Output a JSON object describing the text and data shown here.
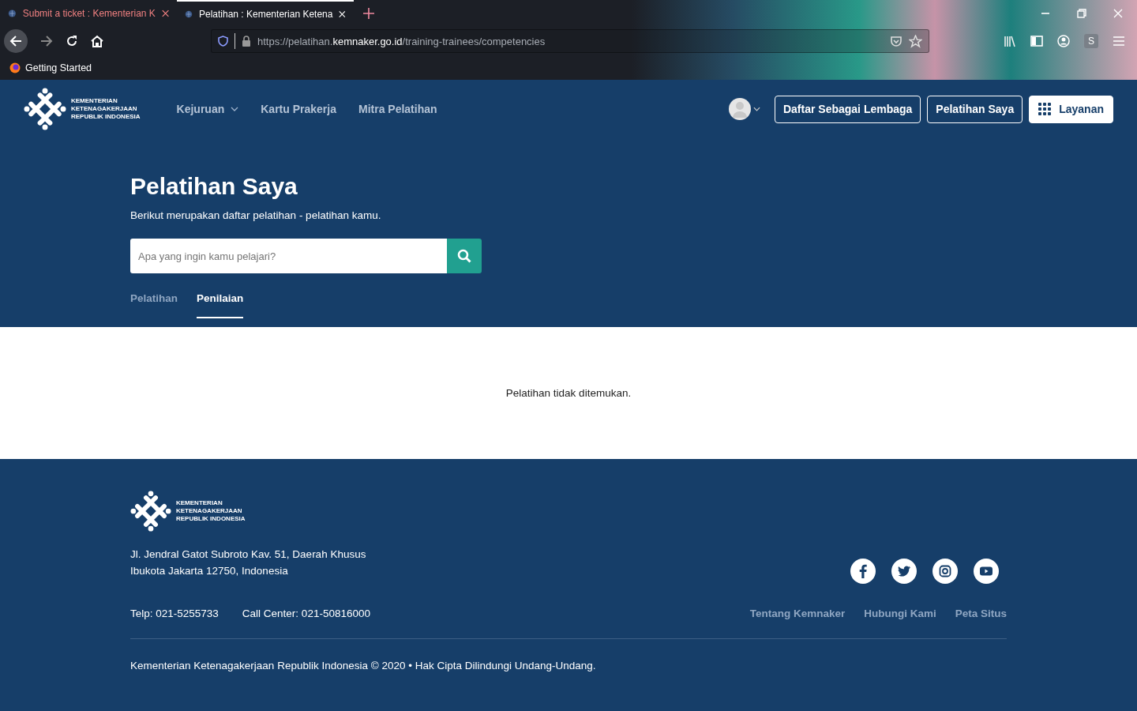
{
  "browser": {
    "tabs": [
      {
        "title": "Submit a ticket : Kementerian K",
        "selected": false
      },
      {
        "title": "Pelatihan : Kementerian Ketena",
        "selected": true
      }
    ],
    "url": {
      "prefix": "https://pelatihan.",
      "domain": "kemnaker.go.id",
      "path": "/training-trainees/competencies"
    },
    "profile_initial": "S",
    "bookmarks": [
      "Getting Started"
    ]
  },
  "header": {
    "logo_lines": [
      "KEMENTERIAN",
      "KETENAGAKERJAAN",
      "REPUBLIK INDONESIA"
    ],
    "nav": [
      {
        "label": "Kejuruan",
        "dropdown": true
      },
      {
        "label": "Kartu Prakerja",
        "dropdown": false
      },
      {
        "label": "Mitra Pelatihan",
        "dropdown": false
      }
    ],
    "buttons": [
      {
        "label": "Daftar Sebagai Lembaga",
        "kind": "outline"
      },
      {
        "label": "Pelatihan Saya",
        "kind": "outline"
      },
      {
        "label": "Layanan",
        "kind": "solid"
      }
    ]
  },
  "hero": {
    "title": "Pelatihan Saya",
    "subtitle": "Berikut merupakan daftar pelatihan - pelatihan kamu.",
    "search": {
      "placeholder": "Apa yang ingin kamu pelajari?"
    },
    "tabs": [
      {
        "label": "Pelatihan",
        "selected": false
      },
      {
        "label": "Penilaian",
        "selected": true
      }
    ]
  },
  "content": {
    "empty_message": "Pelatihan tidak ditemukan."
  },
  "footer": {
    "logo_lines": [
      "KEMENTERIAN",
      "KETENAGAKERJAAN",
      "REPUBLIK INDONESIA"
    ],
    "address": [
      "Jl. Jendral Gatot Subroto Kav. 51, Daerah Khusus",
      "Ibukota Jakarta 12750, Indonesia"
    ],
    "contacts": [
      "Telp: 021-5255733",
      "Call Center: 021-50816000"
    ],
    "socials": [
      {
        "kind": "facebook"
      },
      {
        "kind": "twitter"
      },
      {
        "kind": "instagram"
      },
      {
        "kind": "youtube"
      }
    ],
    "links": [
      "Tentang Kemnaker",
      "Hubungi Kami",
      "Peta Situs"
    ],
    "copyright": "Kementerian Ketenagakerjaan Republik Indonesia © 2020 • Hak Cipta Dilindungi Undang-Undang."
  }
}
